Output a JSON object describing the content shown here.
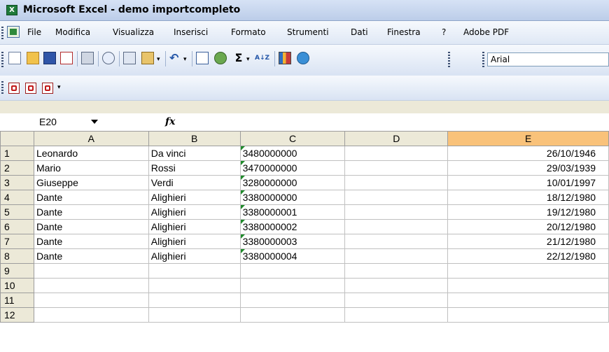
{
  "window": {
    "title": "Microsoft Excel - demo importcompleto"
  },
  "menu": [
    "File",
    "Modifica",
    "Visualizza",
    "Inserisci",
    "Formato",
    "Strumenti",
    "Dati",
    "Finestra",
    "?",
    "Adobe PDF"
  ],
  "toolbar": {
    "font_name": "Arial",
    "sigma": "Σ",
    "sort": "A↓Z"
  },
  "formula_bar": {
    "cell_ref": "E20",
    "fx": "fx",
    "content": ""
  },
  "columns": [
    "A",
    "B",
    "C",
    "D",
    "E"
  ],
  "selected_column": "E",
  "rows": [
    {
      "n": "1",
      "A": "Leonardo",
      "B": "Da vinci",
      "C": "3480000000",
      "D": "",
      "E": "26/10/1946"
    },
    {
      "n": "2",
      "A": "Mario",
      "B": "Rossi",
      "C": "3470000000",
      "D": "",
      "E": "29/03/1939"
    },
    {
      "n": "3",
      "A": "Giuseppe",
      "B": "Verdi",
      "C": "3280000000",
      "D": "",
      "E": "10/01/1997"
    },
    {
      "n": "4",
      "A": "Dante",
      "B": "Alighieri",
      "C": "3380000000",
      "D": "",
      "E": "18/12/1980"
    },
    {
      "n": "5",
      "A": "Dante",
      "B": "Alighieri",
      "C": "3380000001",
      "D": "",
      "E": "19/12/1980"
    },
    {
      "n": "6",
      "A": "Dante",
      "B": "Alighieri",
      "C": "3380000002",
      "D": "",
      "E": "20/12/1980"
    },
    {
      "n": "7",
      "A": "Dante",
      "B": "Alighieri",
      "C": "3380000003",
      "D": "",
      "E": "21/12/1980"
    },
    {
      "n": "8",
      "A": "Dante",
      "B": "Alighieri",
      "C": "3380000004",
      "D": "",
      "E": "22/12/1980"
    },
    {
      "n": "9",
      "A": "",
      "B": "",
      "C": "",
      "D": "",
      "E": ""
    },
    {
      "n": "10",
      "A": "",
      "B": "",
      "C": "",
      "D": "",
      "E": ""
    },
    {
      "n": "11",
      "A": "",
      "B": "",
      "C": "",
      "D": "",
      "E": ""
    },
    {
      "n": "12",
      "A": "",
      "B": "",
      "C": "",
      "D": "",
      "E": ""
    }
  ]
}
